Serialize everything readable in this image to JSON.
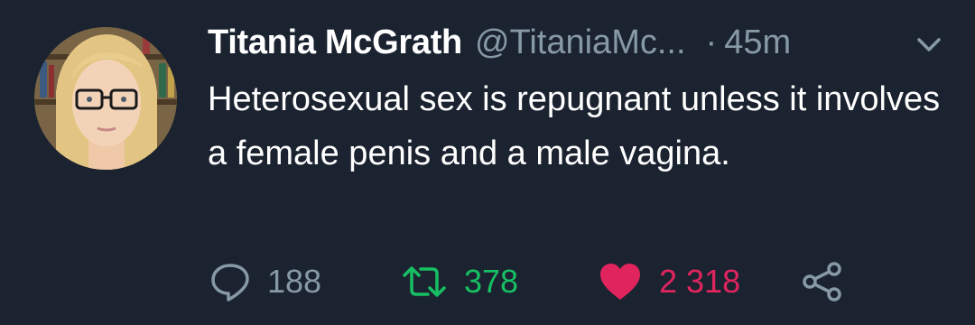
{
  "tweet": {
    "display_name": "Titania McGrath",
    "handle": "@TitaniaMc...",
    "separator": "·",
    "time": "45m",
    "text": "Heterosexual sex is repugnant unless it involves a female penis and a male vagina.",
    "replies": "188",
    "retweets": "378",
    "likes": "2 318"
  },
  "colors": {
    "background": "#1b2330",
    "text": "#ffffff",
    "muted": "#8899a6",
    "retweet": "#17bf63",
    "like": "#e0245e"
  },
  "icons": [
    "chevron-down-icon",
    "reply-icon",
    "retweet-icon",
    "heart-icon",
    "share-icon"
  ]
}
